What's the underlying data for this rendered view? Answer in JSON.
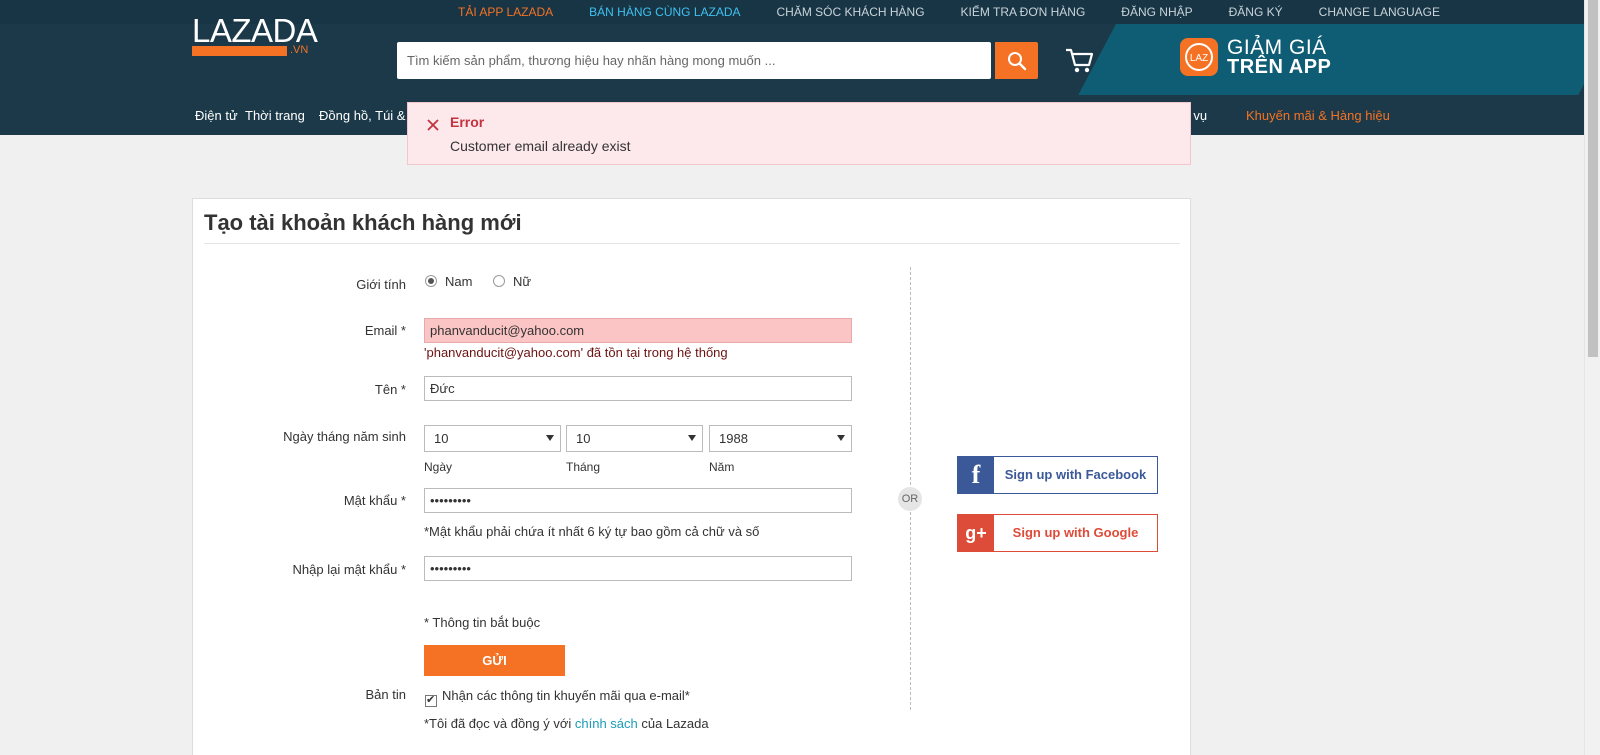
{
  "topbar": {
    "links": [
      "TẢI APP LAZADA",
      "BÁN HÀNG CÙNG LAZADA",
      "CHĂM SÓC KHÁCH HÀNG",
      "KIỂM TRA ĐƠN HÀNG",
      "ĐĂNG NHẬP",
      "ĐĂNG KÝ",
      "CHANGE LANGUAGE"
    ]
  },
  "header": {
    "logo_text": "LAZADA",
    "logo_suffix": ".VN",
    "search_placeholder": "Tìm kiếm sản phẩm, thương hiệu hay nhãn hàng mong muốn ...",
    "app_promo_line1": "GIẢM GIÁ",
    "app_promo_line2": "TRÊN APP",
    "app_logo_text": "LAZ",
    "accent": "#f57224"
  },
  "nav": {
    "items": [
      "Điện tử",
      "Thời trang",
      "Đồng hồ, Túi & F",
      "ch vụ"
    ],
    "promo": "Khuyến mãi & Hàng hiệu"
  },
  "toast": {
    "title": "Error",
    "message": "Customer email already exist",
    "icon": "close-icon"
  },
  "form": {
    "title": "Tạo tài khoản khách hàng mới",
    "gender_label": "Giới tính",
    "gender_male": "Nam",
    "gender_female": "Nữ",
    "gender_selected": "Nam",
    "email_label": "Email *",
    "email_value": "phanvanducit@yahoo.com",
    "email_error": "'phanvanducit@yahoo.com' đã tồn tại trong hệ thống",
    "name_label": "Tên *",
    "name_value": "Đức",
    "dob_label": "Ngày tháng năm sinh",
    "dob_day": "10",
    "dob_month": "10",
    "dob_year": "1988",
    "day_caption": "Ngày",
    "month_caption": "Tháng",
    "year_caption": "Năm",
    "password_label": "Mật khẩu *",
    "password_value": "•••••••••",
    "password_hint": "*Mật khẩu phải chứa ít nhất 6 ký tự bao gồm cả chữ và số",
    "confirm_label": "Nhập lại mật khẩu *",
    "confirm_value": "•••••••••",
    "required_note": "* Thông tin bắt buộc",
    "submit": "GỬI",
    "newsletter_label": "Bản tin",
    "newsletter_text": "Nhận các thông tin khuyến mãi qua e-mail*",
    "newsletter_checked": true,
    "policy_prefix": "*Tôi đã đọc và đồng ý với ",
    "policy_link": "chính sách",
    "policy_suffix": " của Lazada"
  },
  "social": {
    "or": "OR",
    "facebook": "Sign up with Facebook",
    "facebook_icon": "f",
    "google": "Sign up with Google",
    "google_icon": "g+",
    "facebook_color": "#3b5998",
    "google_color": "#dd4b39"
  }
}
